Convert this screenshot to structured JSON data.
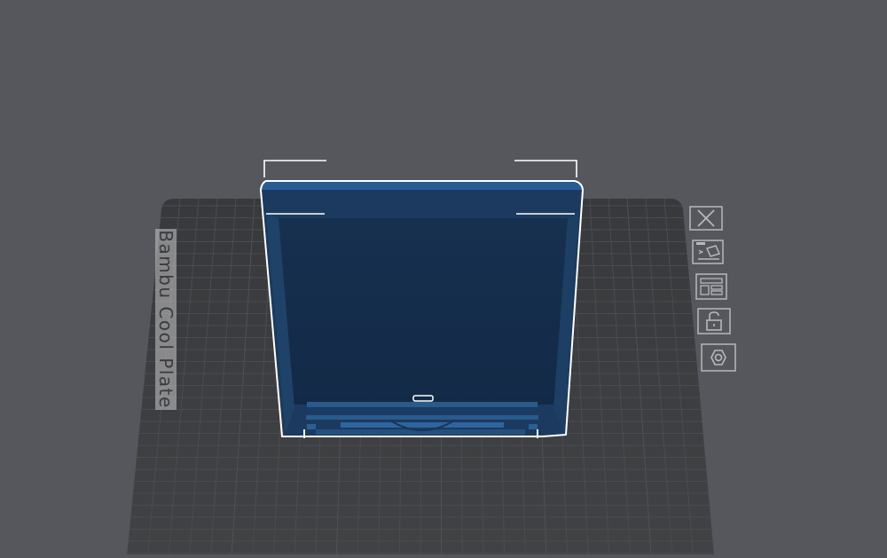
{
  "viewport": {
    "plate_label": "Bambu Cool Plate"
  },
  "colors": {
    "background": "#56575c",
    "plate": "#3d3d40",
    "plate_grid": "#4a4b4f",
    "model_fill": "#1b3556",
    "model_top": "#285d94",
    "selection_outline": "#ffffff",
    "toolbar_icon": "#b6b8bd"
  },
  "toolbar": {
    "items": [
      {
        "name": "close-icon"
      },
      {
        "name": "auto-orient-icon"
      },
      {
        "name": "arrange-icon"
      },
      {
        "name": "lock-icon"
      },
      {
        "name": "nut-icon"
      }
    ]
  }
}
